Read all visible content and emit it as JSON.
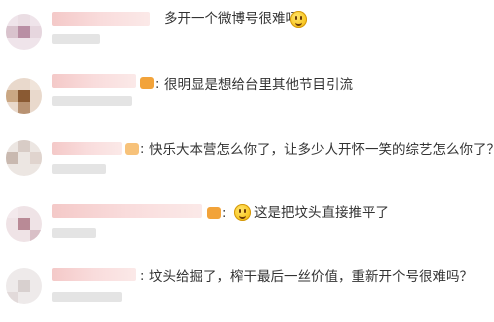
{
  "comments": [
    {
      "text": "多开一个微博号很难吗",
      "emoji": "smile-emoji"
    },
    {
      "text": "很明显是想给台里其他节目引流",
      "emoji": ""
    },
    {
      "text": "快乐大本营怎么你了，让多少人开怀一笑的综艺怎么你了？",
      "emoji": ""
    },
    {
      "text": "这是把坟头直接推平了",
      "emoji": "smile-emoji"
    },
    {
      "text": "坟头给掘了，榨干最后一丝价值，重新开个号很难吗？",
      "emoji": ""
    }
  ],
  "colors": {
    "text": "#333333",
    "name_blur": "#f4c9c8",
    "sub_blur": "#e4e4e4",
    "vip": "#f2a33a"
  }
}
